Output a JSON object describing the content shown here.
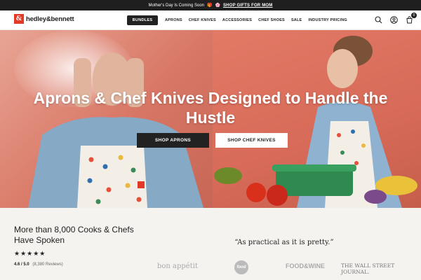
{
  "announcement": {
    "text": "Mother's Day Is Coming Soon",
    "link": "SHOP GIFTS FOR MOM"
  },
  "header": {
    "brand_mark": "&",
    "brand_name": "hedley&bennett",
    "nav": {
      "bundles": "BUNDLES",
      "items": [
        "APRONS",
        "CHEF KNIVES",
        "ACCESSORIES",
        "CHEF SHOES",
        "SALE",
        "INDUSTRY PRICING"
      ]
    },
    "cart_count": "0",
    "icons": [
      "search-icon",
      "account-icon",
      "cart-icon"
    ]
  },
  "hero": {
    "title_line1": "Aprons & Chef Knives Designed to Handle the",
    "title_line2": "Hustle",
    "btn_aprons": "SHOP APRONS",
    "btn_knives": "SHOP CHEF KNIVES"
  },
  "reviews": {
    "heading": "More than 8,000 Cooks & Chefs Have Spoken",
    "stars": "★★★★★",
    "score": "4.6 / 5.0",
    "count": "(8,380 Reviews)",
    "quote": "“As practical as it is pretty.”",
    "press": [
      "bon appétit",
      "food",
      "FOOD&WINE",
      "THE WALL STREET JOURNAL."
    ]
  },
  "colors": {
    "brand_red": "#e23a26",
    "dark": "#1f1f1f",
    "hero_salmon": "#d97766"
  }
}
